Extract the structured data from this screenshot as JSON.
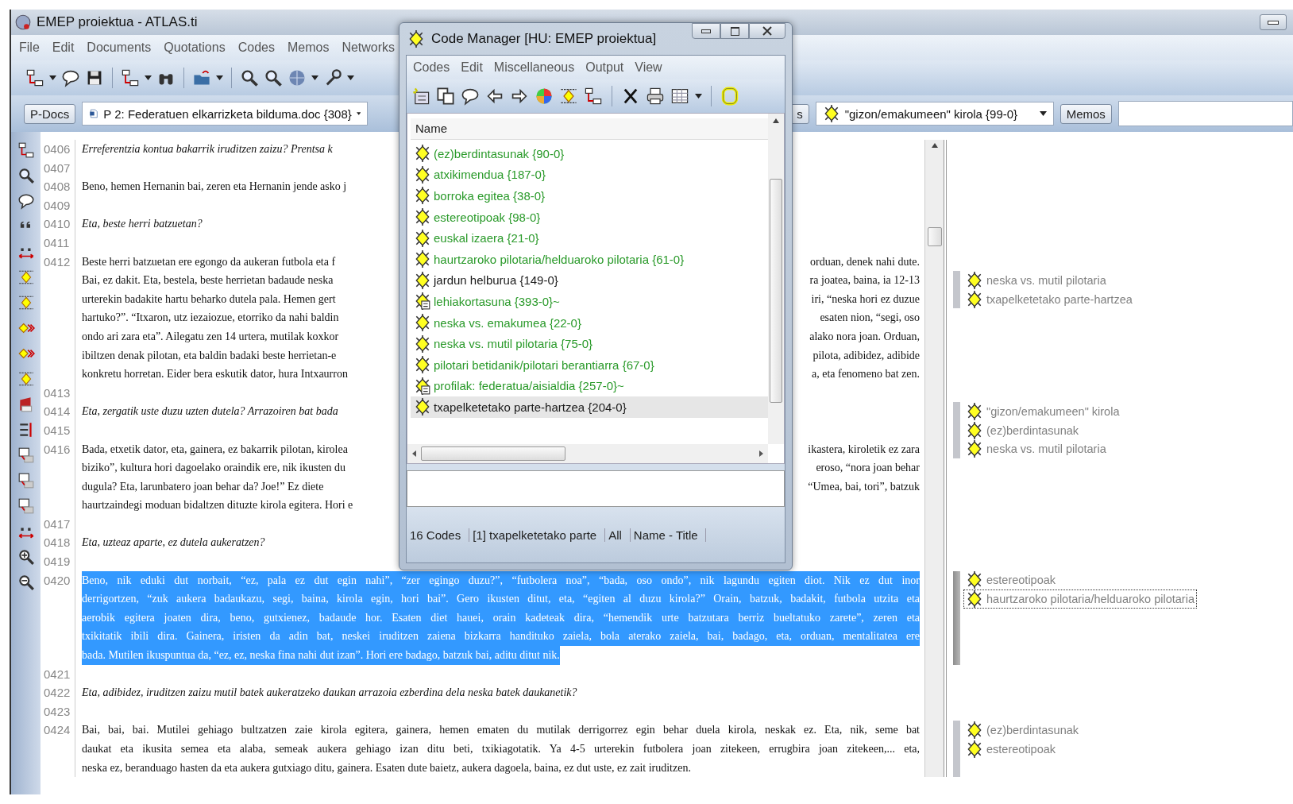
{
  "window": {
    "title": "EMEP proiektua - ATLAS.ti"
  },
  "menu": [
    "File",
    "Edit",
    "Documents",
    "Quotations",
    "Codes",
    "Memos",
    "Networks"
  ],
  "selectors": {
    "pdocs_button": "P-Docs",
    "document_select": "P 2: Federatuen elkarrizketa bilduma.doc {308}",
    "codes_button": "s",
    "code_select": "\"gizon/emakumeen\" kirola {99-0}",
    "memos_button": "Memos"
  },
  "document": {
    "rows": [
      {
        "number": "0406",
        "italic": true,
        "left": "Erreferentzia kontua bakarrik iruditzen zaizu? Prentsa k",
        "selected": false,
        "bar": false
      },
      {
        "number": "0407",
        "bar": false
      },
      {
        "number": "0408",
        "italic": false,
        "left": "Beno, hemen Hernanin bai, zeren eta Hernanin jende asko j",
        "selected": false,
        "bar": false
      },
      {
        "number": "0409",
        "bar": false
      },
      {
        "number": "0410",
        "italic": true,
        "left": "Eta, beste herri batzuetan?",
        "selected": false,
        "bar": false
      },
      {
        "number": "0411",
        "bar": false
      },
      {
        "number": "0412",
        "italic": false,
        "left": "Beste herri batzuetan ere egongo da aukeran futbola eta f",
        "right": "orduan, denek nahi dute.",
        "selected": false,
        "bar": false
      },
      {
        "italic": false,
        "left": "Bai, ez dakit. Eta, bestela, beste herrietan badaude neska",
        "right": "ra joatea, baina, ia 12-13",
        "selected": false,
        "bar": true,
        "code": {
          "label": "neska vs. mutil pilotaria",
          "selected": false
        }
      },
      {
        "italic": false,
        "left": "urterekin badakite hartu beharko dutela pala. Hemen gert",
        "right": "iri, “neska hori ez duzue",
        "selected": false,
        "bar": true,
        "code": {
          "label": "txapelketetako parte-hartzea",
          "selected": false
        }
      },
      {
        "italic": false,
        "left": "hartuko?”. “Itxaron, utz iezaiozue, etorriko da nahi baldin",
        "right": "esaten nion, “segi, oso",
        "selected": false,
        "bar": false
      },
      {
        "italic": false,
        "left": "ondo ari zara eta”. Ailegatu zen 14 urtera, mutilak koxkor",
        "right": "alako nora joan. Orduan,",
        "selected": false,
        "bar": false
      },
      {
        "italic": false,
        "left": "ibiltzen denak pilotan, eta baldin badaki beste herrietan-e",
        "right": "pilota, adibidez, adibide",
        "selected": false,
        "bar": false
      },
      {
        "italic": false,
        "left": "konkretu horretan. Eider bera eskutik dator, hura Intxaurron",
        "right": "a, eta fenomeno bat zen.",
        "selected": false,
        "bar": false
      },
      {
        "number": "0413",
        "bar": false
      },
      {
        "number": "0414",
        "italic": true,
        "left": "Eta, zergatik uste duzu uzten dutela? Arrazoiren bat bada",
        "selected": false,
        "bar": true,
        "code": {
          "label": "\"gizon/emakumeen\" kirola",
          "selected": false
        }
      },
      {
        "number": "0415",
        "bar": true,
        "code": {
          "label": "(ez)berdintasunak",
          "selected": false
        }
      },
      {
        "number": "0416",
        "italic": false,
        "left": "Bada, etxetik dator, eta, gainera, ez bakarrik pilotan, kirolea",
        "right": "ikastera, kiroletik ez zara",
        "selected": false,
        "bar": true,
        "code": {
          "label": "neska vs. mutil pilotaria",
          "selected": false
        }
      },
      {
        "italic": false,
        "left": "biziko”, kultura hori dagoelako oraindik ere, nik ikusten du",
        "right": "eroso, “nora joan behar",
        "selected": false,
        "bar": false
      },
      {
        "italic": false,
        "left": "dugula? Eta, larunbatero joan behar da? Joe!” Ez diete",
        "right": "“Umea, bai, tori”, batzuk",
        "selected": false,
        "bar": false
      },
      {
        "italic": false,
        "left": "haurtzaindegi moduan bidaltzen dituzte kirola egitera. Hori e",
        "selected": false,
        "bar": false
      },
      {
        "number": "0417",
        "bar": false
      },
      {
        "number": "0418",
        "italic": true,
        "text": "Eta, uzteaz aparte, ez dutela aukeratzen?",
        "selected": false,
        "bar": false
      },
      {
        "number": "0419",
        "bar": false
      },
      {
        "number": "0420",
        "italic": false,
        "text": "Beno, nik eduki dut norbait, “ez, pala ez dut egin nahi”, “zer egingo duzu?”, “futbolera noa”, “bada, oso ondo”, nik lagundu egiten diot. Nik ez dut inor",
        "selected": true,
        "bar": true,
        "code": {
          "label": "estereotipoak",
          "selected": false
        }
      },
      {
        "italic": false,
        "text": "derrigortzen, “zuk aukera badaukazu, segi, baina, kirola egin, hori bai”. Gero ikusten ditut, eta, “egiten al duzu kirola?” Orain, batzuk, badakit, futbola utzita eta",
        "selected": true,
        "bar": true,
        "code": {
          "label": "haurtzaroko pilotaria/helduaroko pilotaria",
          "selected": true
        }
      },
      {
        "italic": false,
        "text": "aerobik egitera joaten dira, beno, gutxienez, badaude hor. Esaten diet hauei, orain kadeteak dira, “hemendik urte batzutara berriz bueltatuko zarete”, zeren eta",
        "selected": true,
        "bar": true
      },
      {
        "italic": false,
        "text": "txikitatik ibili dira. Gainera, iristen da adin bat, neskei iruditzen zaiena bizkarra handituko zaiela, bola aterako zaiela, bai, badago, eta, orduan, mentalitatea ere",
        "selected": true,
        "bar": true
      },
      {
        "italic": false,
        "text": "bada. Mutilen ikuspuntua da, “ez, ez, neska fina nahi dut izan”. Hori ere badago, batzuk bai, aditu ditut nik.",
        "selected": true,
        "bar": true
      },
      {
        "number": "0421",
        "bar": false
      },
      {
        "number": "0422",
        "italic": true,
        "text": "Eta, adibidez, iruditzen zaizu mutil batek aukeratzeko daukan arrazoia ezberdina dela neska batek daukanetik?",
        "selected": false,
        "bar": false
      },
      {
        "number": "0423",
        "bar": false
      },
      {
        "number": "0424",
        "italic": false,
        "text": "Bai, bai, bai. Mutilei gehiago bultzatzen zaie kirola egitera, gainera, hemen ematen du mutilak derrigorrez egin behar duela kirola, neskak ez. Eta, nik, seme bat",
        "selected": false,
        "bar": true,
        "code": {
          "label": "(ez)berdintasunak",
          "selected": false
        }
      },
      {
        "italic": false,
        "text": "daukat eta ikusita semea eta alaba, semeak aukera gehiago izan ditu beti, txikiagotatik. Ya 4-5 urterekin futbolera joan zitekeen, errugbira joan zitekeen,... eta,",
        "selected": false,
        "bar": true,
        "code": {
          "label": "estereotipoak",
          "selected": false
        }
      },
      {
        "italic": false,
        "text": "neska ez, beranduago hasten da eta aukera gutxiago ditu, gainera. Esaten dute baietz, aukera dagoela, baina, ez dut uste, ez zait iruditzen.",
        "selected": false,
        "bar": true
      }
    ]
  },
  "code_manager": {
    "title": "Code Manager [HU: EMEP proiektua]",
    "menu": [
      "Codes",
      "Edit",
      "Miscellaneous",
      "Output",
      "View"
    ],
    "column": "Name",
    "codes": [
      {
        "label": "(ez)berdintasunak {90-0}",
        "kind": "code",
        "color": "#2a9a2a",
        "selected": false
      },
      {
        "label": "atxikimendua {187-0}",
        "kind": "code",
        "color": "#2a9a2a",
        "selected": false
      },
      {
        "label": "borroka egitea {38-0}",
        "kind": "code",
        "color": "#2a9a2a",
        "selected": false
      },
      {
        "label": "estereotipoak {98-0}",
        "kind": "code",
        "color": "#2a9a2a",
        "selected": false
      },
      {
        "label": "euskal izaera {21-0}",
        "kind": "code",
        "color": "#2a9a2a",
        "selected": false
      },
      {
        "label": "haurtzaroko pilotaria/helduaroko pilotaria {61-0}",
        "kind": "code",
        "color": "#2a9a2a",
        "selected": false
      },
      {
        "label": "jardun helburua {149-0}",
        "kind": "code",
        "color": "#1a1a1a",
        "selected": false
      },
      {
        "label": "lehiakortasuna {393-0}~",
        "kind": "commented",
        "color": "#2a9a2a",
        "selected": false
      },
      {
        "label": "neska vs. emakumea {22-0}",
        "kind": "code",
        "color": "#2a9a2a",
        "selected": false
      },
      {
        "label": "neska vs. mutil pilotaria {75-0}",
        "kind": "code",
        "color": "#2a9a2a",
        "selected": false
      },
      {
        "label": "pilotari betidanik/pilotari berantiarra {67-0}",
        "kind": "code",
        "color": "#2a9a2a",
        "selected": false
      },
      {
        "label": "profilak: federatua/aisialdia {257-0}~",
        "kind": "commented",
        "color": "#2a9a2a",
        "selected": false
      },
      {
        "label": "txapelketetako parte-hartzea {204-0}",
        "kind": "code",
        "color": "#1a1a1a",
        "selected": true
      }
    ],
    "status": [
      "16 Codes",
      "[1] txapelketetako parte",
      "All",
      "Name - Title"
    ]
  }
}
